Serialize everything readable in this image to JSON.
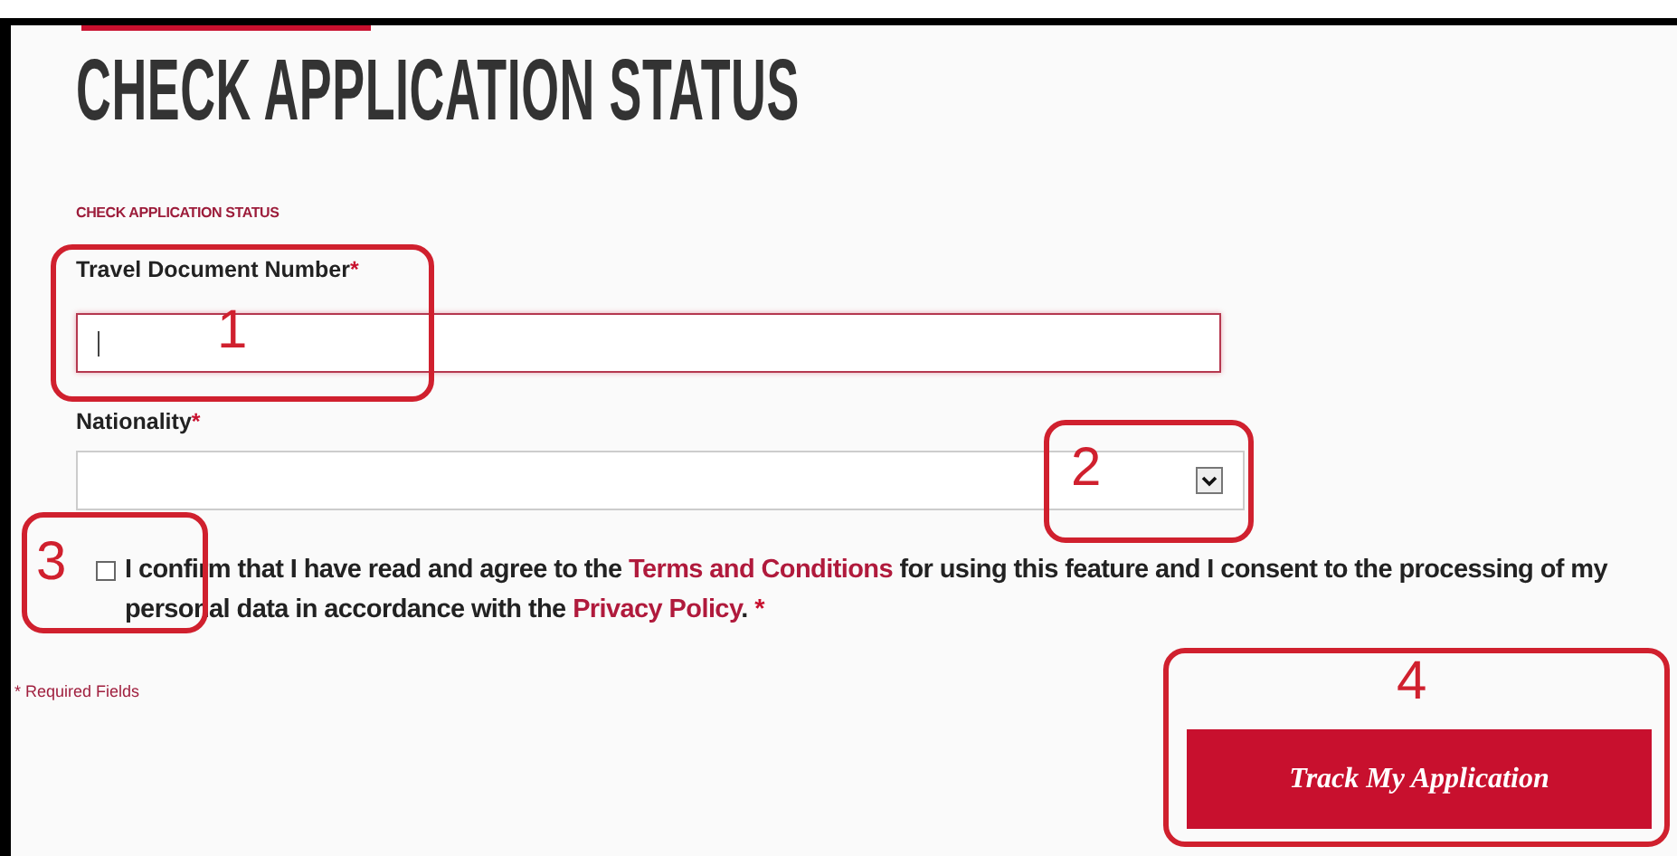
{
  "heading": "CHECK APPLICATION STATUS",
  "section_label": "CHECK APPLICATION STATUS",
  "fields": [
    {
      "kind": "text",
      "label": "Travel Document Number",
      "required_mark": "*",
      "focused": true
    },
    {
      "kind": "select",
      "label": "Nationality",
      "required_mark": "*",
      "focused": false
    }
  ],
  "consent": {
    "checked": false,
    "parts": [
      {
        "kind": "text",
        "text": "I confirm that I have read and agree to the "
      },
      {
        "kind": "link",
        "text": "Terms and Conditions"
      },
      {
        "kind": "text",
        "text": " for using this feature and I consent to the processing of my personal data in accordance with the "
      },
      {
        "kind": "link",
        "text": "Privacy Policy"
      },
      {
        "kind": "text",
        "text": ". "
      },
      {
        "kind": "required",
        "text": "*"
      }
    ]
  },
  "required_note": "* Required Fields",
  "submit_button": "Track My Application",
  "annotations": [
    {
      "label": "1"
    },
    {
      "label": "2"
    },
    {
      "label": "3"
    },
    {
      "label": "4"
    }
  ]
}
